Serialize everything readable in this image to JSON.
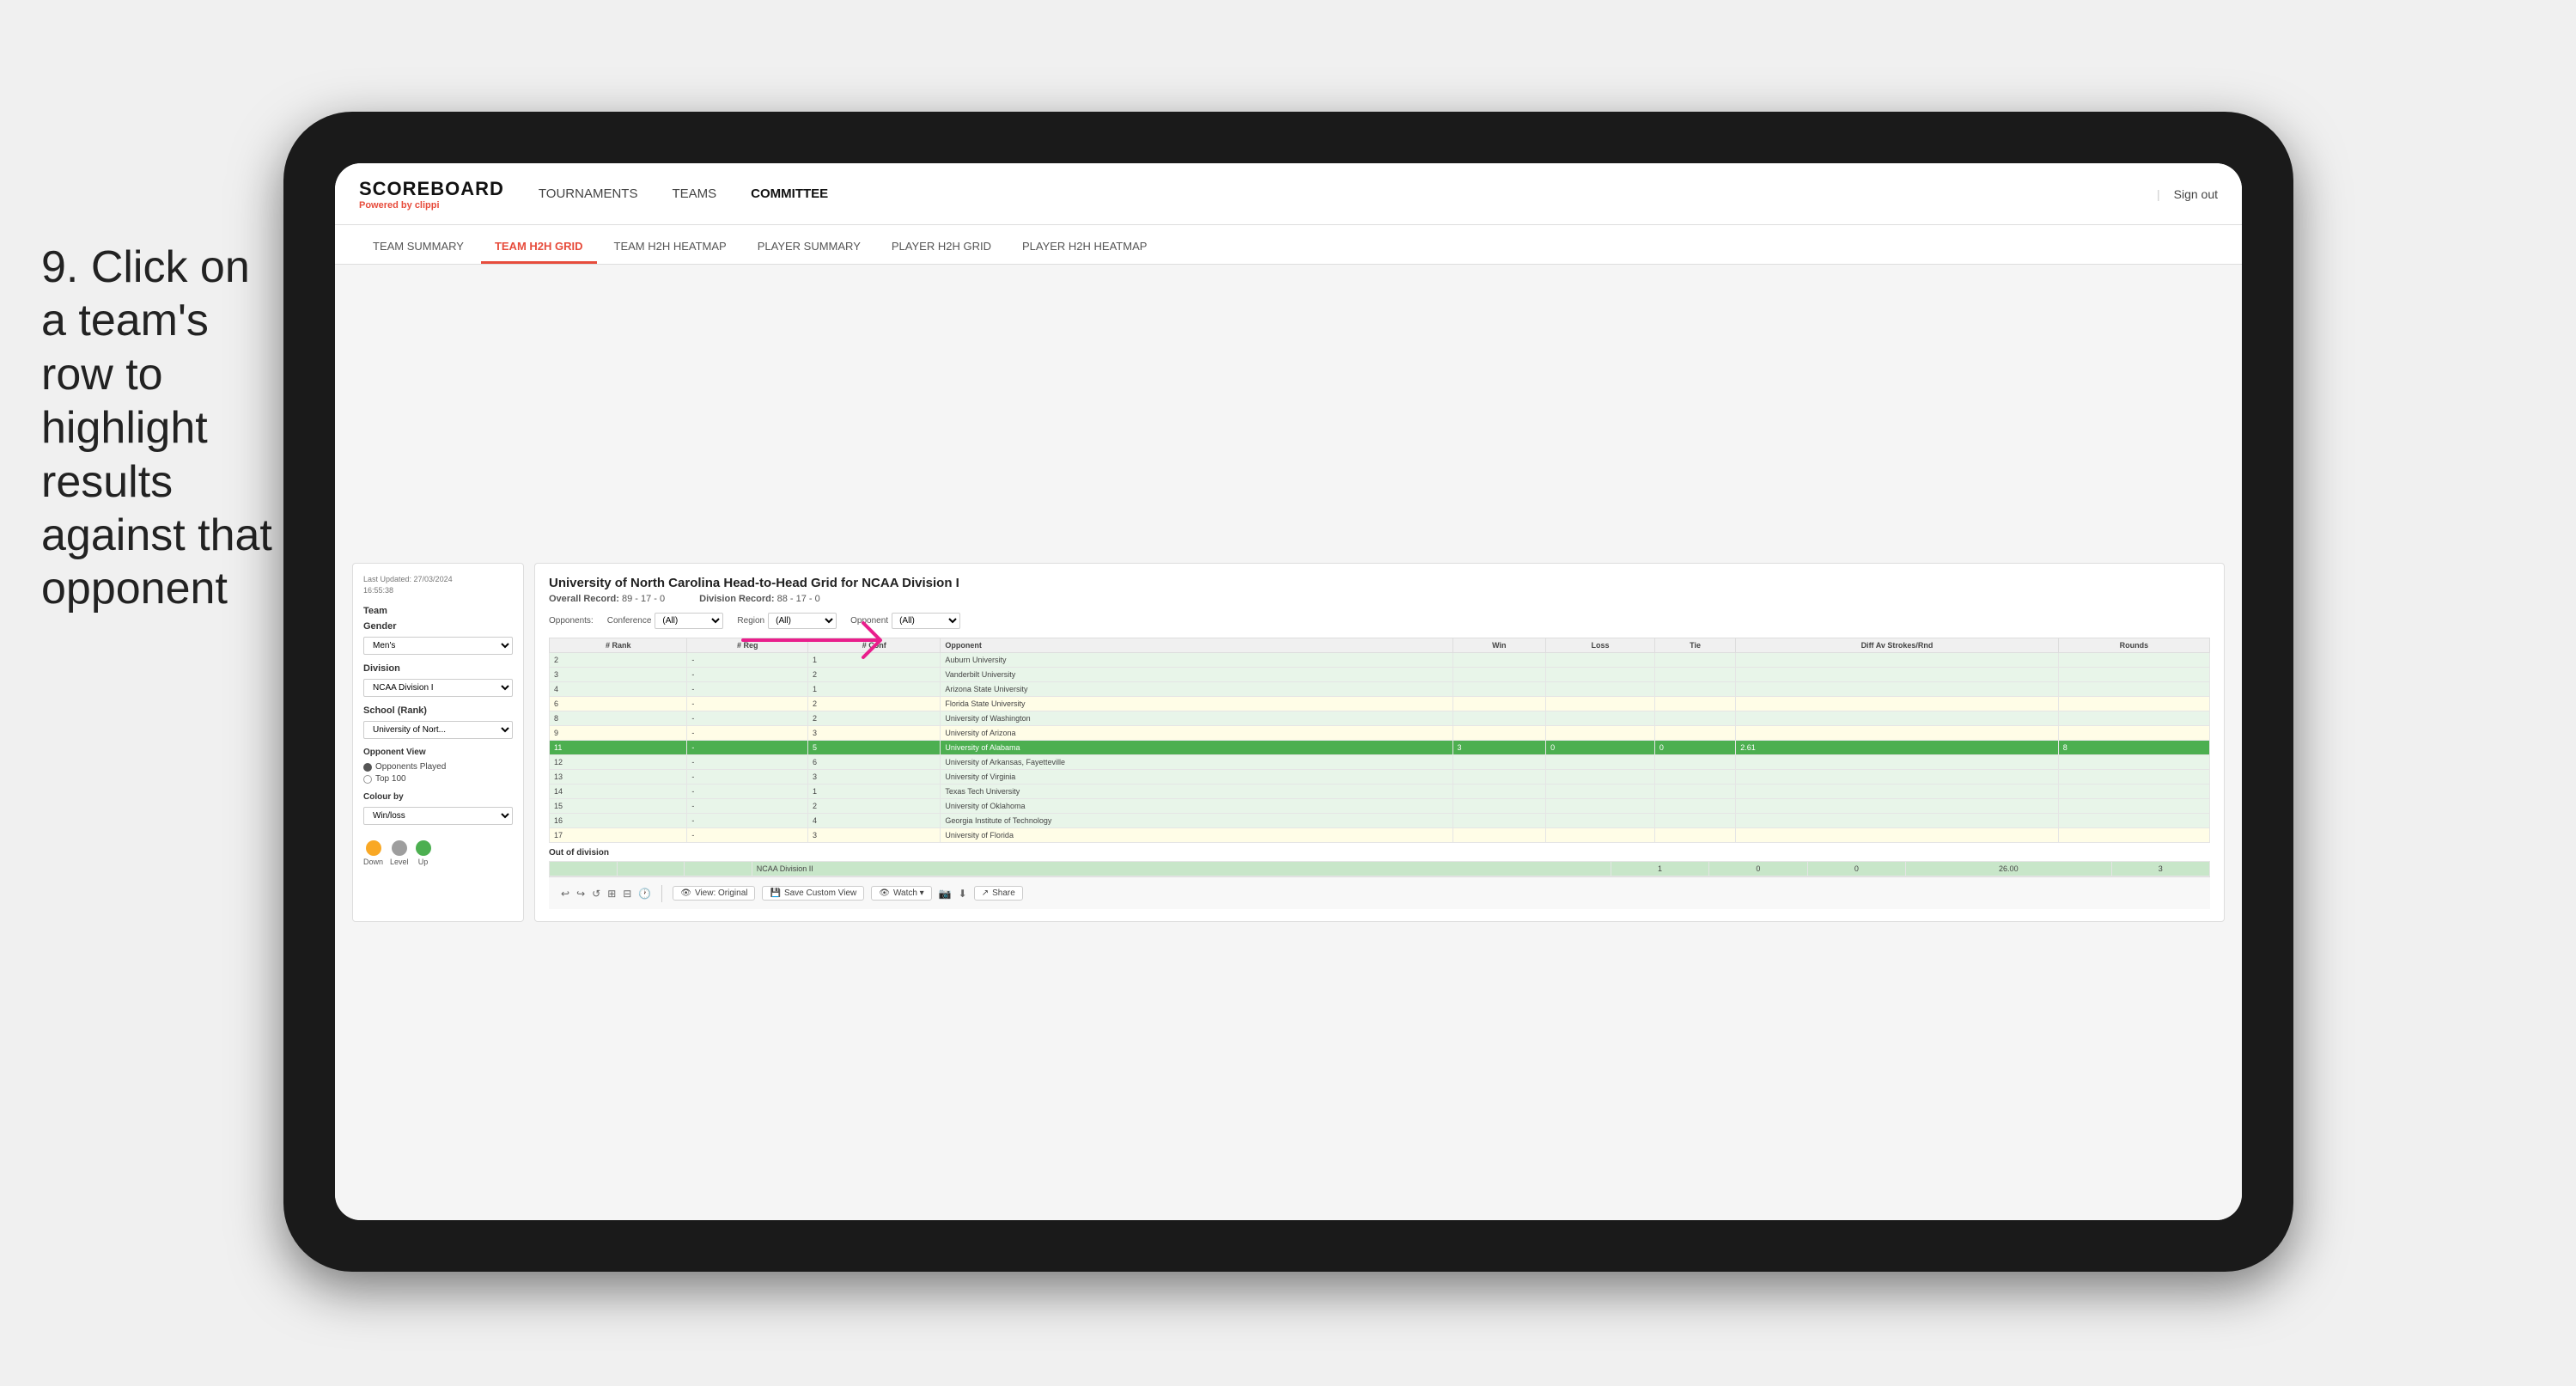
{
  "instruction": {
    "step": "9.",
    "text": "Click on a team's row to highlight results against that opponent"
  },
  "app": {
    "logo": "SCOREBOARD",
    "powered_by": "Powered by",
    "brand": "clippi"
  },
  "nav": {
    "items": [
      {
        "label": "TOURNAMENTS",
        "active": false
      },
      {
        "label": "TEAMS",
        "active": false
      },
      {
        "label": "COMMITTEE",
        "active": true
      }
    ],
    "sign_out": "Sign out"
  },
  "sub_nav": {
    "items": [
      {
        "label": "TEAM SUMMARY",
        "active": false
      },
      {
        "label": "TEAM H2H GRID",
        "active": true
      },
      {
        "label": "TEAM H2H HEATMAP",
        "active": false
      },
      {
        "label": "PLAYER SUMMARY",
        "active": false
      },
      {
        "label": "PLAYER H2H GRID",
        "active": false
      },
      {
        "label": "PLAYER H2H HEATMAP",
        "active": false
      }
    ]
  },
  "sidebar": {
    "last_updated_label": "Last Updated: 27/03/2024",
    "last_updated_time": "16:55:38",
    "team_label": "Team",
    "gender_label": "Gender",
    "gender_value": "Men's",
    "division_label": "Division",
    "division_value": "NCAA Division I",
    "school_label": "School (Rank)",
    "school_value": "University of Nort...",
    "opponent_view_label": "Opponent View",
    "opponent_options": [
      {
        "label": "Opponents Played",
        "selected": true
      },
      {
        "label": "Top 100",
        "selected": false
      }
    ],
    "colour_by_label": "Colour by",
    "colour_by_value": "Win/loss",
    "legend": [
      {
        "label": "Down",
        "color": "#f9a825"
      },
      {
        "label": "Level",
        "color": "#9e9e9e"
      },
      {
        "label": "Up",
        "color": "#4caf50"
      }
    ]
  },
  "report": {
    "title": "University of North Carolina Head-to-Head Grid for NCAA Division I",
    "overall_record_label": "Overall Record:",
    "overall_record": "89 - 17 - 0",
    "division_record_label": "Division Record:",
    "division_record": "88 - 17 - 0",
    "filters": {
      "opponents_label": "Opponents:",
      "conference_label": "Conference",
      "conference_value": "(All)",
      "region_label": "Region",
      "region_value": "(All)",
      "opponent_label": "Opponent",
      "opponent_value": "(All)"
    },
    "table": {
      "headers": [
        "#\nRank",
        "#\nReg",
        "#\nConf",
        "Opponent",
        "Win",
        "Loss",
        "Tie",
        "Diff Av\nStrokes/Rnd",
        "Rounds"
      ],
      "rows": [
        {
          "rank": "2",
          "reg": "-",
          "conf": "1",
          "opponent": "Auburn University",
          "win": "",
          "loss": "",
          "tie": "",
          "diff": "",
          "rounds": "",
          "row_color": "light-green"
        },
        {
          "rank": "3",
          "reg": "-",
          "conf": "2",
          "opponent": "Vanderbilt University",
          "win": "",
          "loss": "",
          "tie": "",
          "diff": "",
          "rounds": "",
          "row_color": "light-green"
        },
        {
          "rank": "4",
          "reg": "-",
          "conf": "1",
          "opponent": "Arizona State University",
          "win": "",
          "loss": "",
          "tie": "",
          "diff": "",
          "rounds": "",
          "row_color": "light-green"
        },
        {
          "rank": "6",
          "reg": "-",
          "conf": "2",
          "opponent": "Florida State University",
          "win": "",
          "loss": "",
          "tie": "",
          "diff": "",
          "rounds": "",
          "row_color": "light-yellow"
        },
        {
          "rank": "8",
          "reg": "-",
          "conf": "2",
          "opponent": "University of Washington",
          "win": "",
          "loss": "",
          "tie": "",
          "diff": "",
          "rounds": "",
          "row_color": "light-green"
        },
        {
          "rank": "9",
          "reg": "-",
          "conf": "3",
          "opponent": "University of Arizona",
          "win": "",
          "loss": "",
          "tie": "",
          "diff": "",
          "rounds": "",
          "row_color": "light-yellow"
        },
        {
          "rank": "11",
          "reg": "-",
          "conf": "5",
          "opponent": "University of Alabama",
          "win": "3",
          "loss": "0",
          "tie": "0",
          "diff": "2.61",
          "rounds": "8",
          "row_color": "highlighted"
        },
        {
          "rank": "12",
          "reg": "-",
          "conf": "6",
          "opponent": "University of Arkansas, Fayetteville",
          "win": "",
          "loss": "",
          "tie": "",
          "diff": "",
          "rounds": "",
          "row_color": "light-green"
        },
        {
          "rank": "13",
          "reg": "-",
          "conf": "3",
          "opponent": "University of Virginia",
          "win": "",
          "loss": "",
          "tie": "",
          "diff": "",
          "rounds": "",
          "row_color": "light-green"
        },
        {
          "rank": "14",
          "reg": "-",
          "conf": "1",
          "opponent": "Texas Tech University",
          "win": "",
          "loss": "",
          "tie": "",
          "diff": "",
          "rounds": "",
          "row_color": "light-green"
        },
        {
          "rank": "15",
          "reg": "-",
          "conf": "2",
          "opponent": "University of Oklahoma",
          "win": "",
          "loss": "",
          "tie": "",
          "diff": "",
          "rounds": "",
          "row_color": "light-green"
        },
        {
          "rank": "16",
          "reg": "-",
          "conf": "4",
          "opponent": "Georgia Institute of Technology",
          "win": "",
          "loss": "",
          "tie": "",
          "diff": "",
          "rounds": "",
          "row_color": "light-green"
        },
        {
          "rank": "17",
          "reg": "-",
          "conf": "3",
          "opponent": "University of Florida",
          "win": "",
          "loss": "",
          "tie": "",
          "diff": "",
          "rounds": "",
          "row_color": "light-yellow"
        }
      ],
      "out_of_division_label": "Out of division",
      "out_of_division_row": {
        "division": "NCAA Division II",
        "win": "1",
        "loss": "0",
        "tie": "0",
        "diff": "26.00",
        "rounds": "3"
      }
    }
  },
  "toolbar": {
    "buttons": [
      {
        "label": "View: Original"
      },
      {
        "label": "Save Custom View"
      },
      {
        "label": "Watch"
      },
      {
        "label": "Share"
      }
    ]
  },
  "colors": {
    "accent_red": "#e74c3c",
    "highlight_green": "#4caf50",
    "light_green_row": "#e8f5e9",
    "light_yellow_row": "#fffde7",
    "legend_down": "#f9a825",
    "legend_level": "#9e9e9e",
    "legend_up": "#4caf50"
  }
}
